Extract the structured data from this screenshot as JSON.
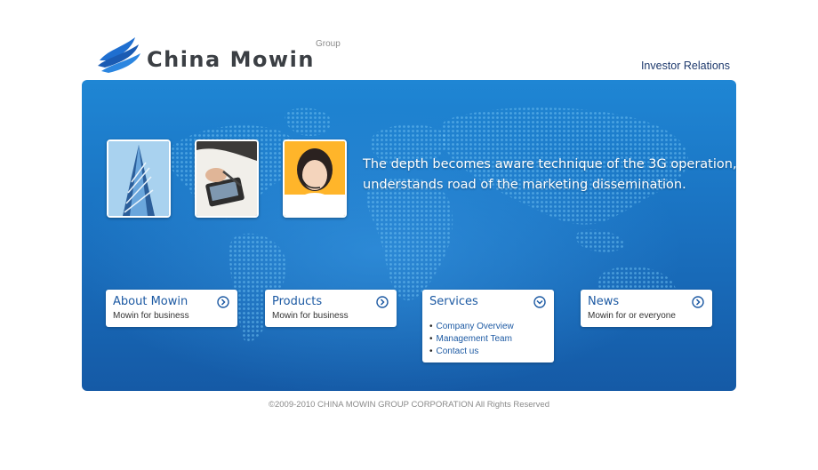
{
  "header": {
    "logo_text": "China Mowin",
    "logo_group": "Group",
    "investor_link": "Investor Relations"
  },
  "hero": {
    "tagline_line1": "The depth becomes aware technique of the 3G operation,",
    "tagline_line2": "understands road of the marketing dissemination.",
    "photos": [
      "building-photo",
      "pda-hand-photo",
      "call-center-photo"
    ]
  },
  "cards": [
    {
      "title": "About Mowin",
      "subtitle": "Mowin for business",
      "icon": "chevron-right-circle-icon"
    },
    {
      "title": "Products",
      "subtitle": "Mowin for business",
      "icon": "chevron-right-circle-icon"
    },
    {
      "title": "Services",
      "icon": "chevron-down-circle-icon",
      "links": [
        "Company Overview",
        "Management Team",
        "Contact us"
      ]
    },
    {
      "title": "News",
      "subtitle": "Mowin for or everyone",
      "icon": "chevron-right-circle-icon"
    }
  ],
  "footer": {
    "copyright": "©2009-2010 CHINA MOWIN GROUP CORPORATION All Rights Reserved"
  },
  "colors": {
    "accent": "#1d5aa3",
    "hero_top": "#1f86d4",
    "hero_bottom": "#155aa6"
  }
}
